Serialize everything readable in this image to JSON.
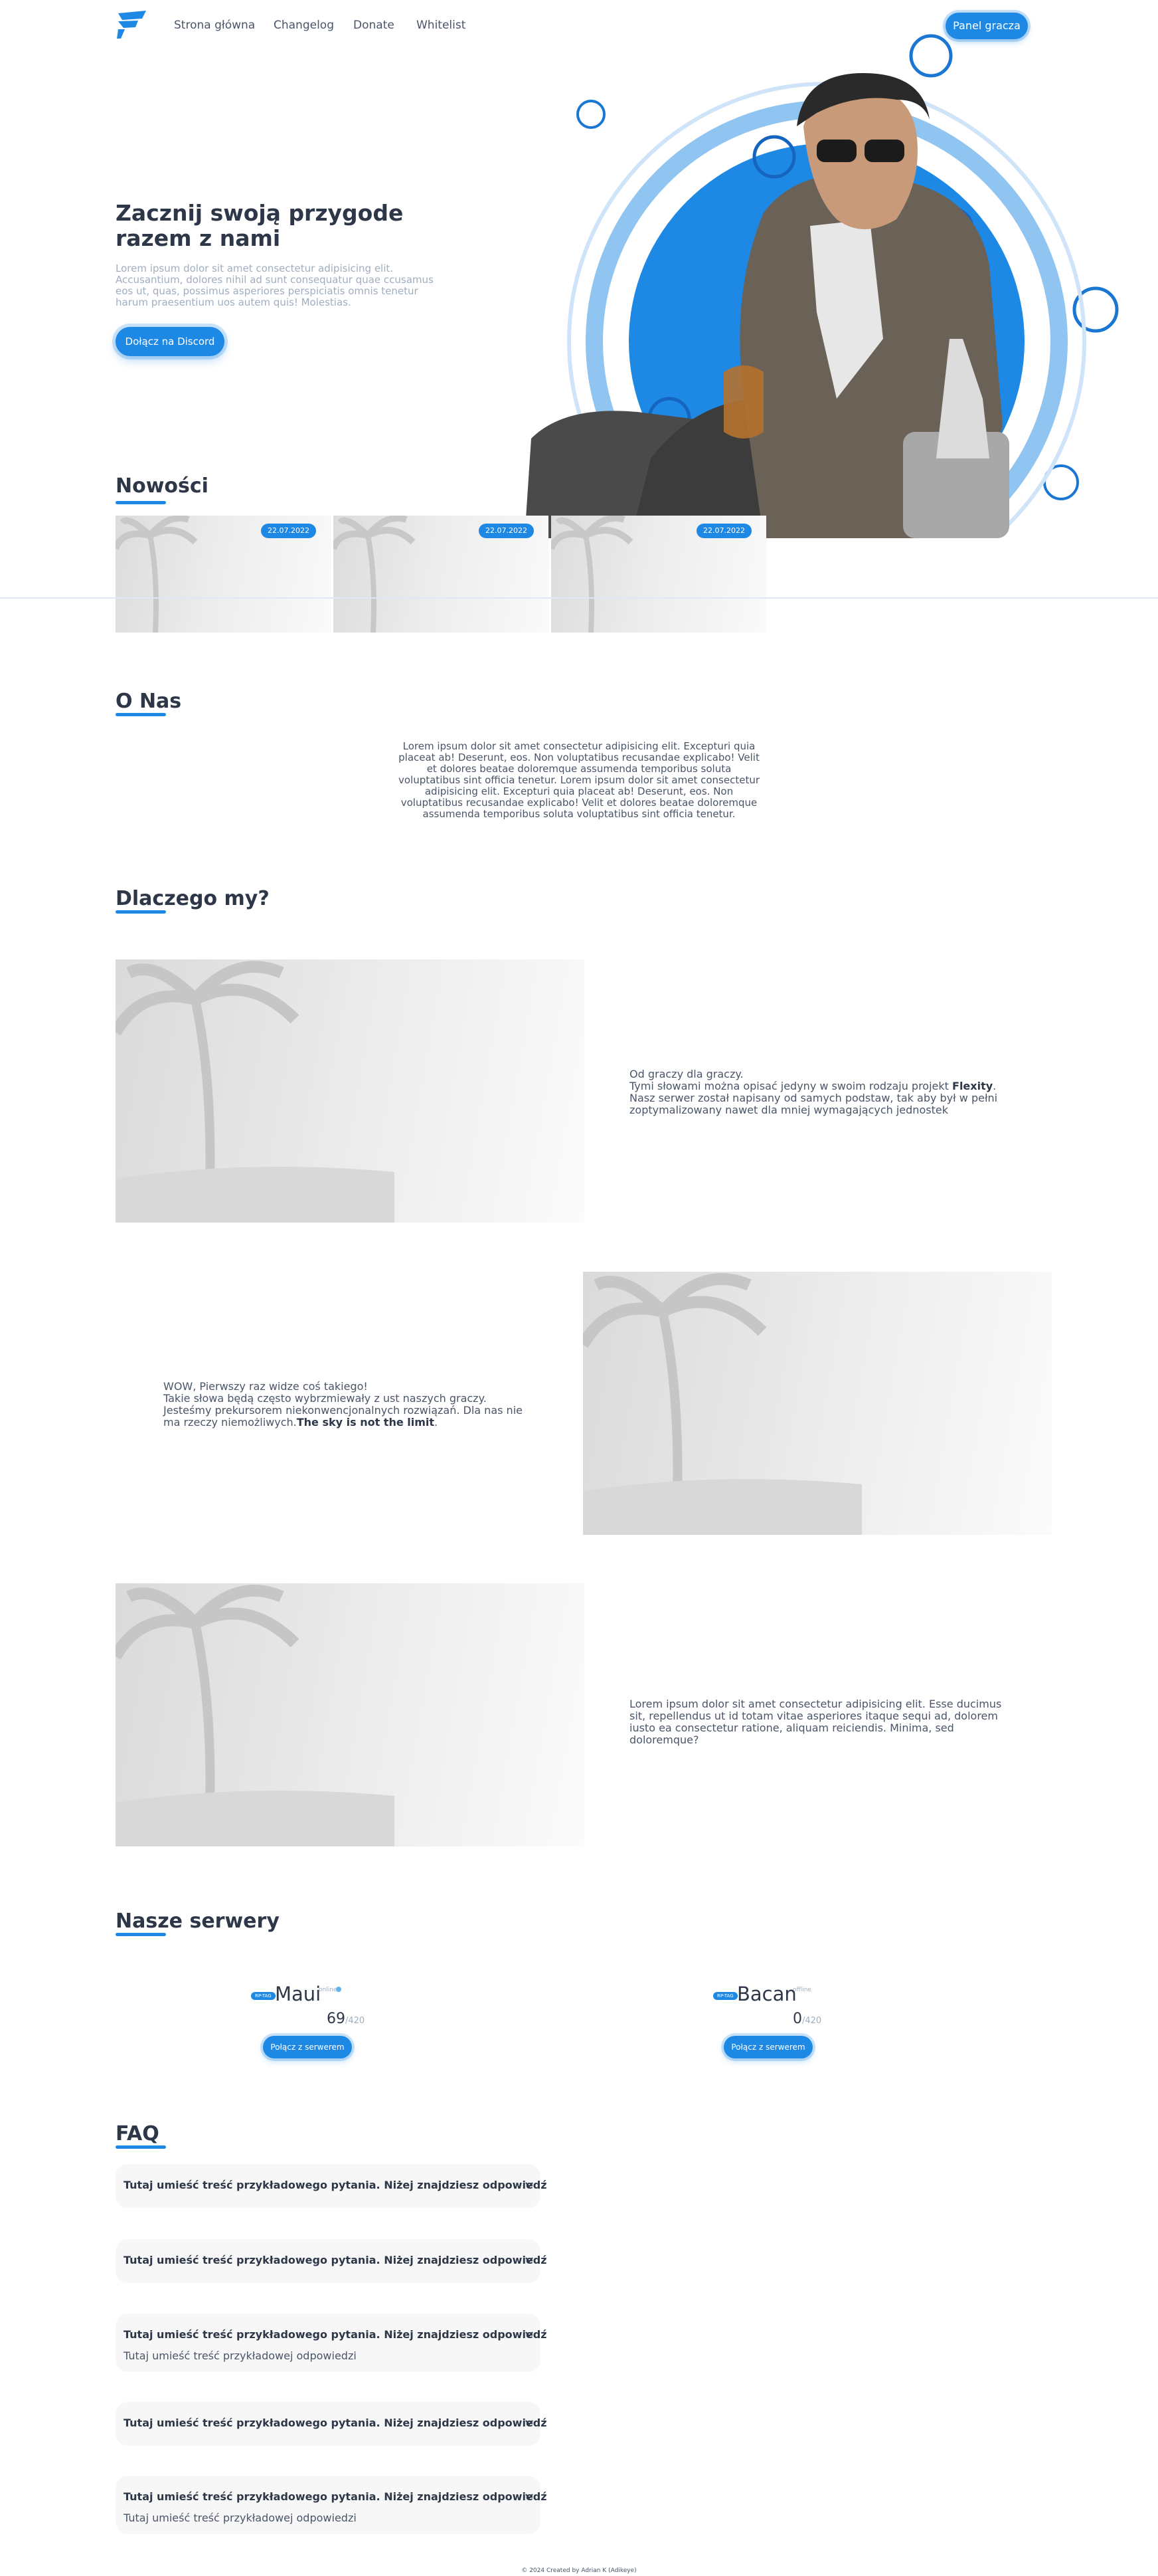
{
  "nav": {
    "logo_icon": "flexity-logo-icon",
    "links": [
      "Strona główna",
      "Changelog",
      "Donate",
      "Whitelist"
    ],
    "panel_button": "Panel gracza"
  },
  "hero": {
    "title": "Zacznij swoją przygode razem z nami",
    "text": "Lorem ipsum dolor sit amet consectetur adipisicing elit. Accusantium, dolores nihil ad sunt consequatur quae ccusamus eos ut, quas, possimus asperiores perspiciatis omnis tenetur harum praesentium uos autem quis! Molestias.",
    "button": "Dołącz na Discord"
  },
  "news": {
    "title": "Nowości",
    "cards": [
      {
        "date": "22.07.2022"
      },
      {
        "date": "22.07.2022"
      },
      {
        "date": "22.07.2022"
      }
    ]
  },
  "about": {
    "title": "O Nas",
    "text": "Lorem ipsum dolor sit amet consectetur adipisicing elit. Excepturi quia placeat ab! Deserunt, eos. Non voluptatibus recusandae explicabo! Velit et dolores beatae doloremque assumenda temporibus soluta voluptatibus sint officia tenetur. Lorem ipsum dolor sit amet consectetur adipisicing elit. Excepturi quia placeat ab! Deserunt, eos. Non voluptatibus recusandae explicabo! Velit et dolores beatae doloremque assumenda temporibus soluta voluptatibus sint officia tenetur."
  },
  "why": {
    "title": "Dlaczego my?",
    "block1": {
      "line1": "Od graczy dla graczy.",
      "line2_pre": "Tymi słowami można opisać jedyny w swoim rodzaju projekt ",
      "line2_bold": "Flexity",
      "line2_post": ".",
      "line3": "Nasz serwer został napisany od samych podstaw, tak aby był w pełni zoptymalizowany nawet dla mniej wymagających jednostek"
    },
    "block2": {
      "line1": "WOW, Pierwszy raz widze coś takiego!",
      "line2": "Takie słowa będą często wybrzmiewały z ust naszych graczy. Jesteśmy prekursorem niekonwencjonalnych rozwiązań. Dla nas nie ma rzeczy niemożliwych.",
      "bold": "The sky is not the limit",
      "post": "."
    },
    "block3": {
      "text": "Lorem ipsum dolor sit amet consectetur adipisicing elit. Esse ducimus sit, repellendus ut id totam vitae asperiores itaque sequi ad, dolorem iusto ea consectetur ratione, aliquam reiciendis. Minima, sed doloremque?"
    }
  },
  "servers": {
    "title": "Nasze serwery",
    "items": [
      {
        "tag": "RP-TAG",
        "name": "Maui",
        "status": "online",
        "status_color": "#63b3ed",
        "players": "69",
        "max": "/420",
        "button": "Połącz z serwerem"
      },
      {
        "tag": "RP-TAG",
        "name": "Bacan",
        "status": "offline",
        "status_color": "",
        "players": "0",
        "max": "/420",
        "button": "Połącz z serwerem"
      }
    ]
  },
  "faq": {
    "title": "FAQ",
    "items": [
      {
        "question": "Tutaj umieść treść przykładowego pytania. Niżej znajdziesz odpowiedź",
        "answer": ""
      },
      {
        "question": "Tutaj umieść treść przykładowego pytania. Niżej znajdziesz odpowiedź",
        "answer": ""
      },
      {
        "question": "Tutaj umieść treść przykładowego pytania. Niżej znajdziesz odpowiedź",
        "answer": "Tutaj umieść treść przykładowej odpowiedzi"
      },
      {
        "question": "Tutaj umieść treść przykładowego pytania. Niżej znajdziesz odpowiedź",
        "answer": ""
      },
      {
        "question": "Tutaj umieść treść przykładowego pytania. Niżej znajdziesz odpowiedź",
        "answer": "Tutaj umieść treść przykładowej odpowiedzi"
      }
    ]
  },
  "footer": {
    "text": "© 2024 Created by Adrian K (Adikeye)"
  },
  "colors": {
    "accent": "#1e88e5",
    "heading": "#2d3748",
    "muted": "#a0aec0"
  }
}
